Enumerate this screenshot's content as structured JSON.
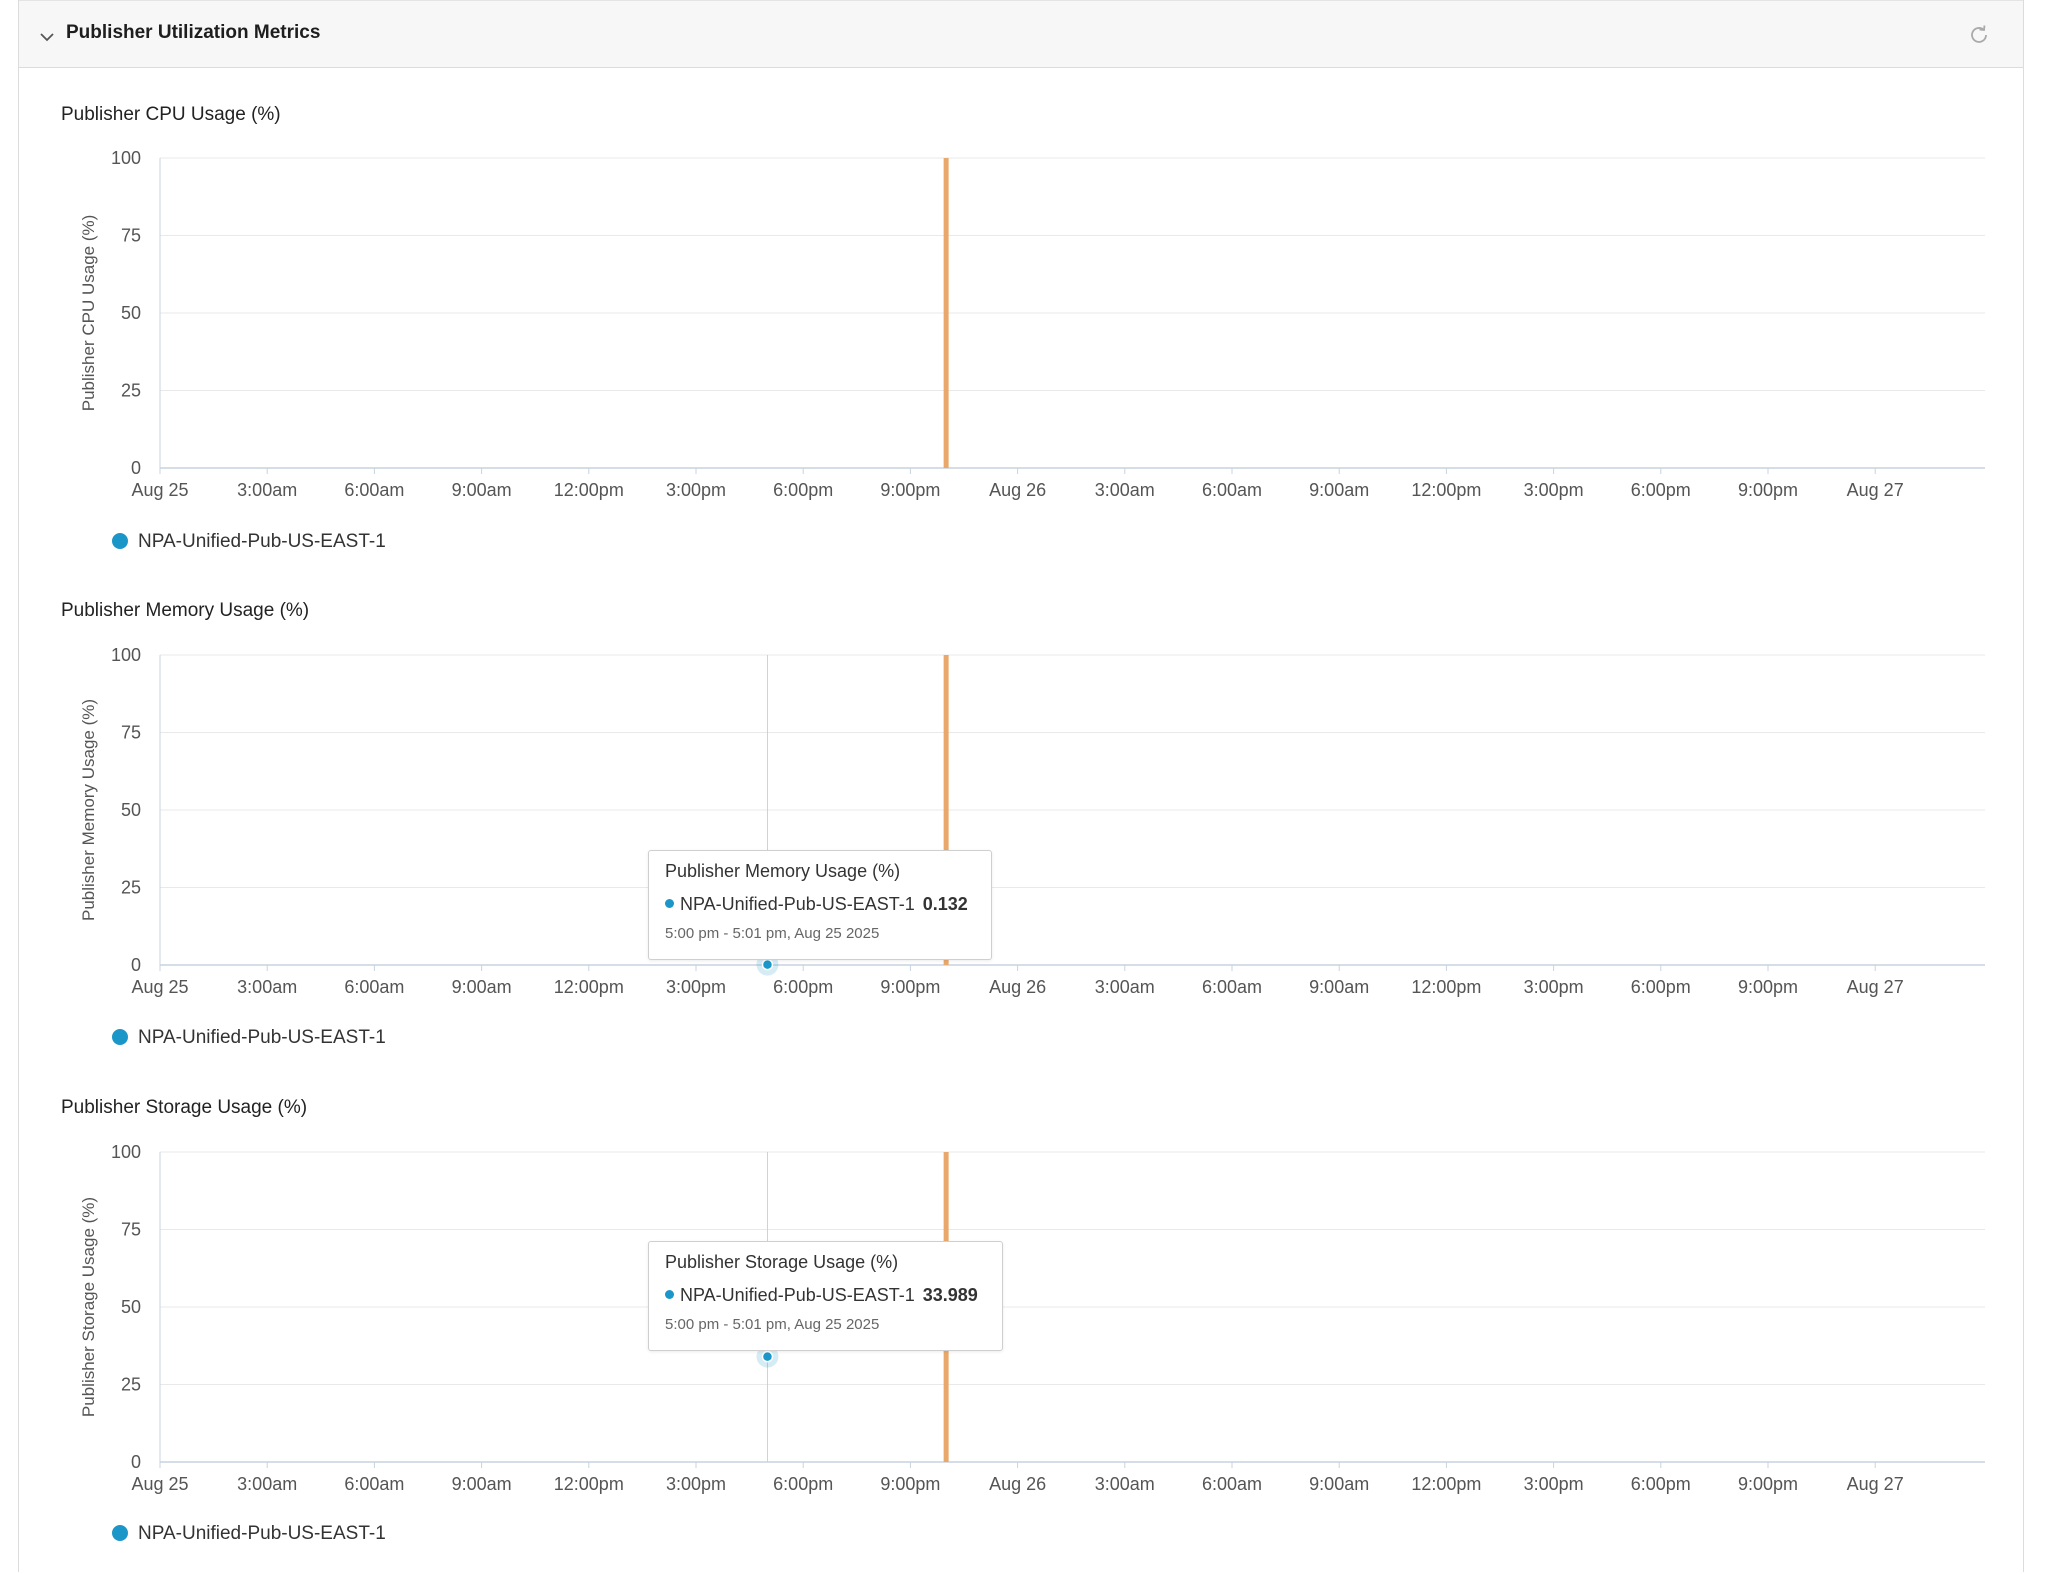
{
  "header": {
    "title": "Publisher Utilization Metrics"
  },
  "colors": {
    "series": "#1a96c8",
    "event": "#e8a86b",
    "grid": "#e9e9e9",
    "axis": "#c7d3de",
    "tick": "#555555"
  },
  "chart_data": [
    {
      "type": "line",
      "title": "Publisher CPU Usage (%)",
      "ylabel": "Publisher CPU Usage (%)",
      "xlabel": "",
      "ylim": [
        0,
        100
      ],
      "yticks": [
        0,
        25,
        50,
        75,
        100
      ],
      "xtick_labels": [
        "Aug 25",
        "3:00am",
        "6:00am",
        "9:00am",
        "12:00pm",
        "3:00pm",
        "6:00pm",
        "9:00pm",
        "Aug 26",
        "3:00am",
        "6:00am",
        "9:00am",
        "12:00pm",
        "3:00pm",
        "6:00pm",
        "9:00pm",
        "Aug 27"
      ],
      "x_range_hours": [
        0,
        51.3
      ],
      "event_marker_hour": 22.0,
      "series": [
        {
          "name": "NPA-Unified-Pub-US-EAST-1",
          "points": []
        }
      ],
      "legend": "bottom-left",
      "grid": true
    },
    {
      "type": "line",
      "title": "Publisher Memory Usage (%)",
      "ylabel": "Publisher Memory Usage (%)",
      "xlabel": "",
      "ylim": [
        0,
        100
      ],
      "yticks": [
        0,
        25,
        50,
        75,
        100
      ],
      "xtick_labels": [
        "Aug 25",
        "3:00am",
        "6:00am",
        "9:00am",
        "12:00pm",
        "3:00pm",
        "6:00pm",
        "9:00pm",
        "Aug 26",
        "3:00am",
        "6:00am",
        "9:00am",
        "12:00pm",
        "3:00pm",
        "6:00pm",
        "9:00pm",
        "Aug 27"
      ],
      "x_range_hours": [
        0,
        51.3
      ],
      "event_marker_hour": 22.0,
      "series": [
        {
          "name": "NPA-Unified-Pub-US-EAST-1",
          "points": [
            {
              "hour": 17.0,
              "value": 0.132
            }
          ]
        }
      ],
      "legend": "bottom-left",
      "grid": true,
      "tooltip": {
        "title": "Publisher Memory Usage (%)",
        "series": "NPA-Unified-Pub-US-EAST-1",
        "value": "0.132",
        "time": "5:00 pm - 5:01 pm, Aug 25 2025"
      }
    },
    {
      "type": "line",
      "title": "Publisher Storage Usage (%)",
      "ylabel": "Publisher Storage Usage (%)",
      "xlabel": "",
      "ylim": [
        0,
        100
      ],
      "yticks": [
        0,
        25,
        50,
        75,
        100
      ],
      "xtick_labels": [
        "Aug 25",
        "3:00am",
        "6:00am",
        "9:00am",
        "12:00pm",
        "3:00pm",
        "6:00pm",
        "9:00pm",
        "Aug 26",
        "3:00am",
        "6:00am",
        "9:00am",
        "12:00pm",
        "3:00pm",
        "6:00pm",
        "9:00pm",
        "Aug 27"
      ],
      "x_range_hours": [
        0,
        51.3
      ],
      "event_marker_hour": 22.0,
      "series": [
        {
          "name": "NPA-Unified-Pub-US-EAST-1",
          "points": [
            {
              "hour": 17.0,
              "value": 33.989
            }
          ]
        }
      ],
      "legend": "bottom-left",
      "grid": true,
      "tooltip": {
        "title": "Publisher Storage Usage (%)",
        "series": "NPA-Unified-Pub-US-EAST-1",
        "value": "33.989",
        "time": "5:00 pm - 5:01 pm, Aug 25 2025"
      }
    }
  ]
}
